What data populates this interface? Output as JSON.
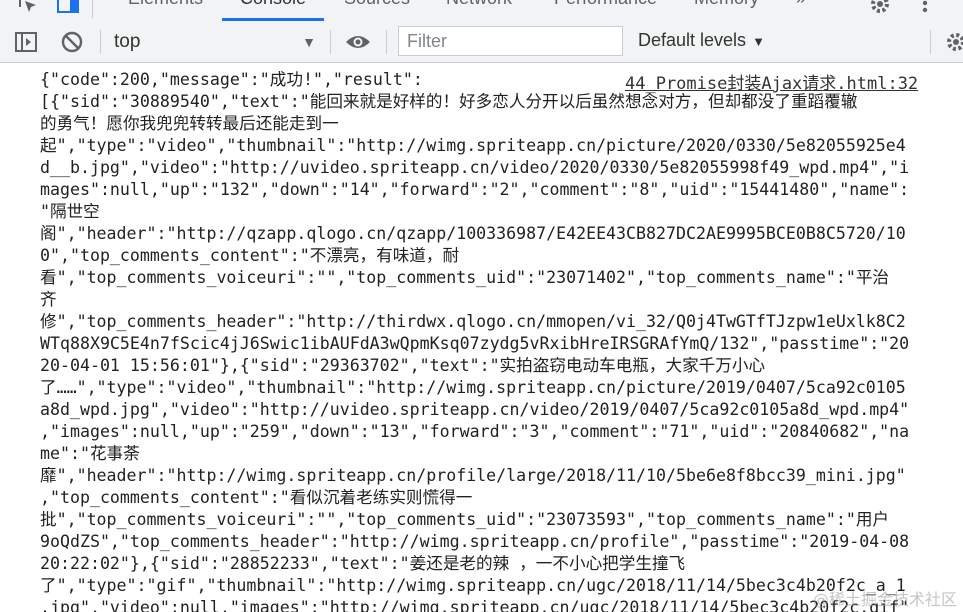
{
  "tabs": [
    "Elements",
    "Console",
    "Sources",
    "Network",
    "Performance",
    "Memory"
  ],
  "tabs_more": "»",
  "toolbar": {
    "context": "top",
    "filter_placeholder": "Filter",
    "levels_label": "Default levels"
  },
  "log": {
    "source": "44_Promise封装Ajax请求.html:32",
    "lines": [
      "{\"code\":200,\"message\":\"成功!\",\"result\":",
      "[{\"sid\":\"30889540\",\"text\":\"能回来就是好样的！好多恋人分开以后虽然想念对方，但却都没了重蹈覆辙",
      "的勇气！愿你我兜兜转转最后还能走到一",
      "起\",\"type\":\"video\",\"thumbnail\":\"http://wimg.spriteapp.cn/picture/2020/0330/5e82055925e4",
      "d__b.jpg\",\"video\":\"http://uvideo.spriteapp.cn/video/2020/0330/5e82055998f49_wpd.mp4\",\"i",
      "mages\":null,\"up\":\"132\",\"down\":\"14\",\"forward\":\"2\",\"comment\":\"8\",\"uid\":\"15441480\",\"name\":",
      "\"隔世空",
      "阁\",\"header\":\"http://qzapp.qlogo.cn/qzapp/100336987/E42EE43CB827DC2AE9995BCE0B8C5720/10",
      "0\",\"top_comments_content\":\"不漂亮，有味道，耐",
      "看\",\"top_comments_voiceuri\":\"\",\"top_comments_uid\":\"23071402\",\"top_comments_name\":\"平治",
      "齐",
      "修\",\"top_comments_header\":\"http://thirdwx.qlogo.cn/mmopen/vi_32/Q0j4TwGTfTJzpw1eUxlk8C2",
      "WTq88X9C5E4n7fScic4jJ6Swic1ibAUFdA3wQpmKsq07zydg5vRxibHreIRSGRAfYmQ/132\",\"passtime\":\"20",
      "20-04-01 15:56:01\"},{\"sid\":\"29363702\",\"text\":\"实拍盗窃电动车电瓶，大家千万小心",
      "了……\",\"type\":\"video\",\"thumbnail\":\"http://wimg.spriteapp.cn/picture/2019/0407/5ca92c0105",
      "a8d_wpd.jpg\",\"video\":\"http://uvideo.spriteapp.cn/video/2019/0407/5ca92c0105a8d_wpd.mp4\"",
      ",\"images\":null,\"up\":\"259\",\"down\":\"13\",\"forward\":\"3\",\"comment\":\"71\",\"uid\":\"20840682\",\"na",
      "me\":\"花事荼",
      "靡\",\"header\":\"http://wimg.spriteapp.cn/profile/large/2018/11/10/5be6e8f8bcc39_mini.jpg\"",
      ",\"top_comments_content\":\"看似沉着老练实则慌得一",
      "批\",\"top_comments_voiceuri\":\"\",\"top_comments_uid\":\"23073593\",\"top_comments_name\":\"用户",
      "9oQdZS\",\"top_comments_header\":\"http://wimg.spriteapp.cn/profile\",\"passtime\":\"2019-04-08",
      "20:22:02\"},{\"sid\":\"28852233\",\"text\":\"姜还是老的辣 ，一不小心把学生撞飞",
      "了\",\"type\":\"gif\",\"thumbnail\":\"http://wimg.spriteapp.cn/ugc/2018/11/14/5bec3c4b20f2c_a_1",
      ".jpg\",\"video\":null,\"images\":\"http://wimg.spriteapp.cn/ugc/2018/11/14/5bec3c4b20f2c.gif\""
    ]
  },
  "watermark": "@稀土掘金技术社区"
}
